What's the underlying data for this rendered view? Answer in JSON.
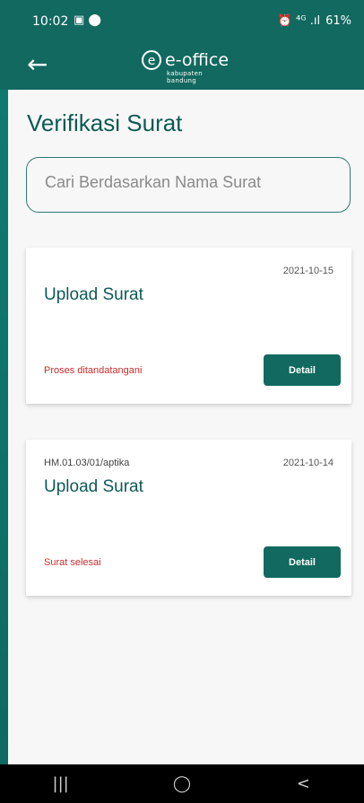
{
  "status": {
    "time": "10:02",
    "left_icons": "▣ ⬤",
    "right_icons": "⏰ ⁴ᴳ .ıl",
    "battery": "61%"
  },
  "appbar": {
    "back_icon": "←",
    "logo_mark": "e",
    "logo_text": "e-office",
    "logo_sub": "kabupaten bandung"
  },
  "page": {
    "title": "Verifikasi Surat",
    "search_placeholder": "Cari Berdasarkan Nama Surat"
  },
  "cards": [
    {
      "code": "",
      "date": "2021-10-15",
      "title": "Upload Surat",
      "status": "Proses ditandatangani",
      "button": "Detail"
    },
    {
      "code": "HM.01.03/01/aptika",
      "date": "2021-10-14",
      "title": "Upload Surat",
      "status": "Surat selesai",
      "button": "Detail"
    }
  ],
  "nav": {
    "recents": "|||",
    "home": "◯",
    "back": "<"
  },
  "colors": {
    "primary": "#11695f",
    "status_text": "#cc2b2b",
    "background": "#f7f7f7"
  }
}
